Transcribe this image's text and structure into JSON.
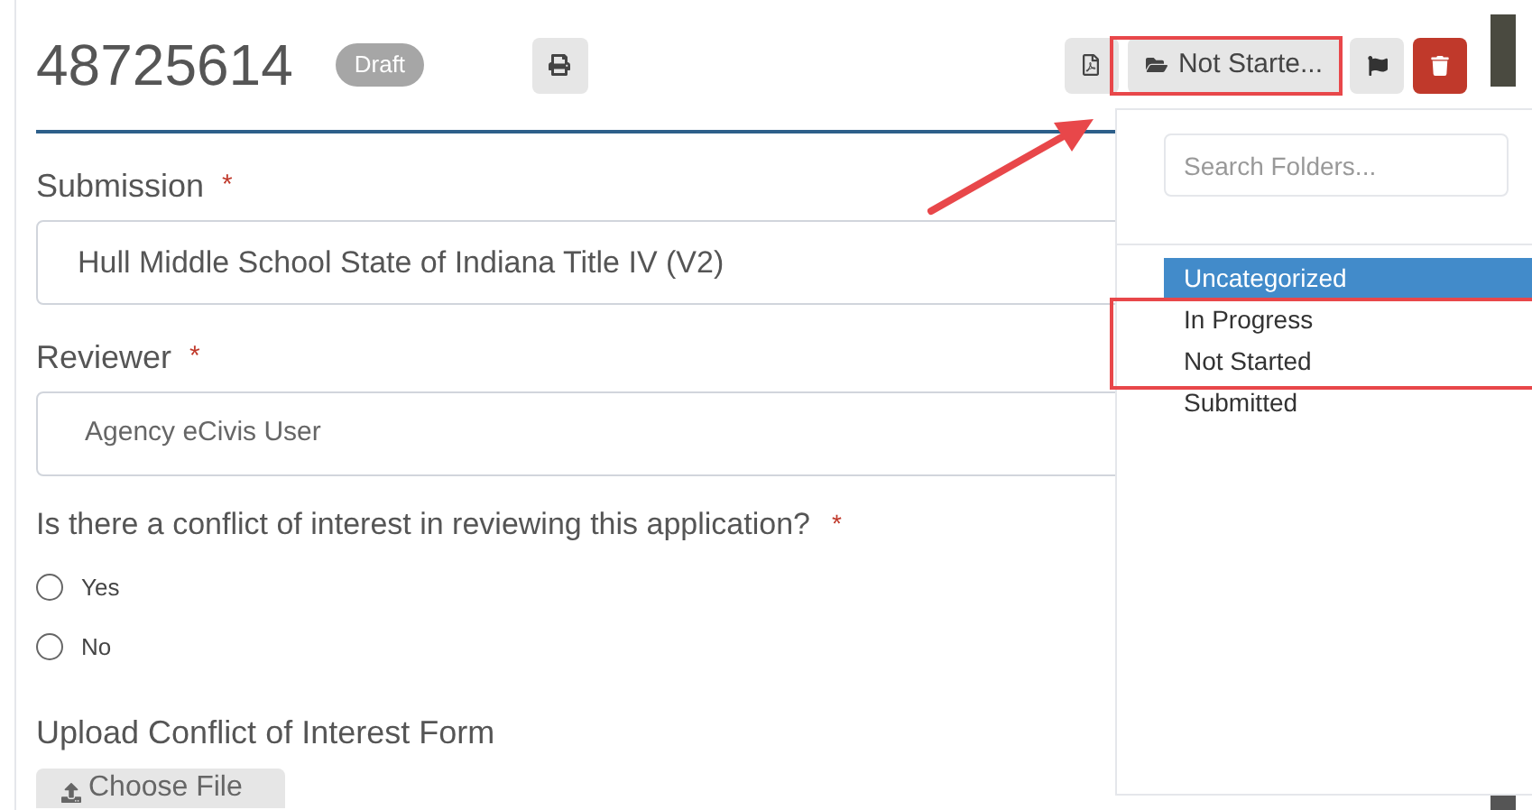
{
  "header": {
    "title": "48725614",
    "status_badge": "Draft",
    "folder_button": "Not Starte..."
  },
  "folder_menu": {
    "search": {
      "placeholder": "Search Folders..."
    },
    "items": [
      {
        "label": "Uncategorized",
        "selected": true
      },
      {
        "label": "In Progress",
        "selected": false
      },
      {
        "label": "Not Started",
        "selected": false
      },
      {
        "label": "Submitted",
        "selected": false
      }
    ]
  },
  "form": {
    "fields": [
      {
        "kind": "text",
        "label": "Submission",
        "required": "*",
        "value": "Hull Middle School State of Indiana Title IV (V2)"
      },
      {
        "kind": "select",
        "label": "Reviewer",
        "required": "*",
        "value": "Agency eCivis User"
      }
    ],
    "question": {
      "label": "Is there a conflict of interest in reviewing this application?",
      "required": "*",
      "options": [
        {
          "label": "Yes",
          "selected": false
        },
        {
          "label": "No",
          "selected": false
        }
      ]
    },
    "upload": {
      "label": "Upload Conflict of Interest Form",
      "button": "Choose File"
    }
  }
}
